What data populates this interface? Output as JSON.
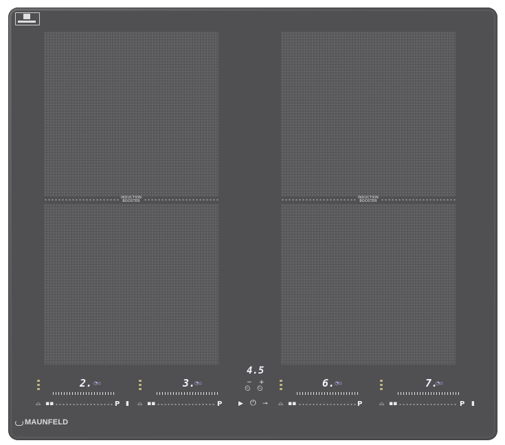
{
  "booster": {
    "line1": "INDUCTION",
    "line2": "BOOSTER"
  },
  "zones": [
    {
      "digit": "2.",
      "p_label": "P"
    },
    {
      "digit": "3.",
      "p_label": "P"
    },
    {
      "digit": "6.",
      "p_label": "P"
    },
    {
      "digit": "7.",
      "p_label": "P"
    }
  ],
  "timer": {
    "value": "4.5",
    "minus": "−",
    "plus": "+"
  },
  "brand": {
    "name": "MAUNFELD"
  },
  "colors": {
    "frame": "#555557",
    "glass": "#505052",
    "digit": "#f4f0ff",
    "indicator": "#c9b4ff",
    "led": "#c6b780"
  }
}
